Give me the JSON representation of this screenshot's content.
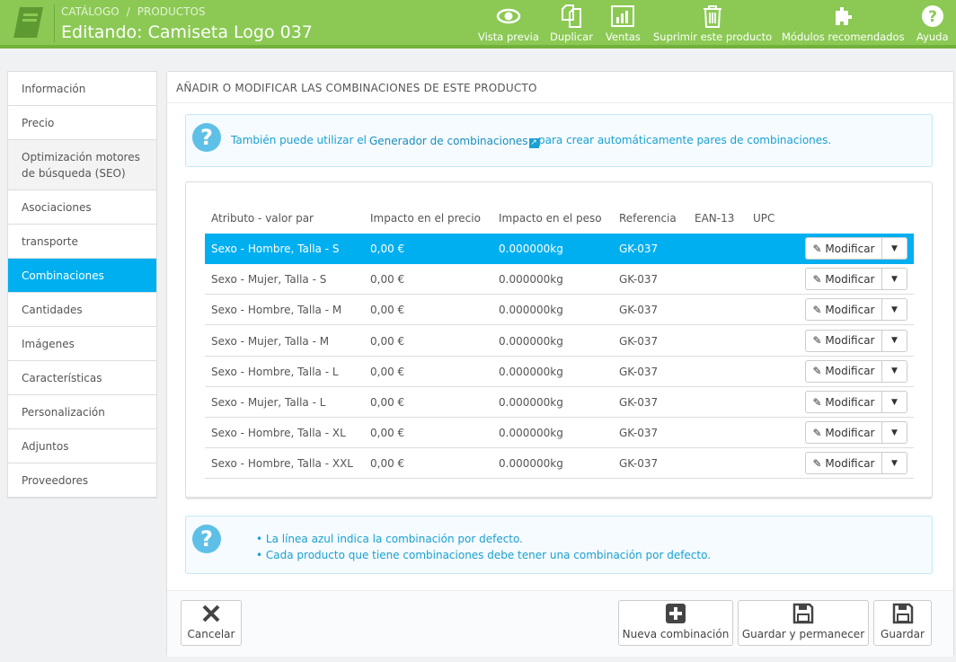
{
  "header": {
    "breadcrumb": [
      "CATÁLOGO",
      "/",
      "PRODUCTOS"
    ],
    "title": "Editando: Camiseta Logo 037",
    "toolbar": [
      {
        "label": "Vista previa",
        "icon": "eye-icon"
      },
      {
        "label": "Duplicar",
        "icon": "copy-icon"
      },
      {
        "label": "Ventas",
        "icon": "bar-chart-icon"
      },
      {
        "label": "Suprimir este producto",
        "icon": "trash-icon"
      },
      {
        "label": "Módulos recomendados",
        "icon": "puzzle-icon"
      },
      {
        "label": "Ayuda",
        "icon": "help-icon"
      }
    ]
  },
  "sidebar": {
    "items": [
      "Información",
      "Precio",
      "Optimización motores de búsqueda (SEO)",
      "Asociaciones",
      "transporte",
      "Combinaciones",
      "Cantidades",
      "Imágenes",
      "Características",
      "Personalización",
      "Adjuntos",
      "Proveedores"
    ],
    "active": "Combinaciones"
  },
  "panel": {
    "title": "Añadir o modificar las combinaciones de este producto",
    "info1": {
      "before": "También puede utilizar el",
      "link": "Generador de combinaciones",
      "after": "para crear automáticamente pares de combinaciones."
    },
    "table": {
      "headers": [
        "Atributo - valor par",
        "Impacto en el precio",
        "Impacto en el peso",
        "Referencia",
        "EAN-13",
        "UPC"
      ],
      "rows": [
        [
          "Sexo - Hombre, Talla - S",
          "0,00 €",
          "0.000000kg",
          "GK-037"
        ],
        [
          "Sexo - Mujer, Talla - S",
          "0,00 €",
          "0.000000kg",
          "GK-037"
        ],
        [
          "Sexo - Hombre, Talla - M",
          "0,00 €",
          "0.000000kg",
          "GK-037"
        ],
        [
          "Sexo - Mujer, Talla - M",
          "0,00 €",
          "0.000000kg",
          "GK-037"
        ],
        [
          "Sexo - Hombre, Talla - L",
          "0,00 €",
          "0.000000kg",
          "GK-037"
        ],
        [
          "Sexo - Mujer, Talla - L",
          "0,00 €",
          "0.000000kg",
          "GK-037"
        ],
        [
          "Sexo - Hombre, Talla - XL",
          "0,00 €",
          "0.000000kg",
          "GK-037"
        ],
        [
          "Sexo - Hombre, Talla - XXL",
          "0,00 €",
          "0.000000kg",
          "GK-037"
        ]
      ],
      "action_label": "Modificar"
    },
    "info2": [
      "La línea azul indica la combinación por defecto.",
      "Cada producto que tiene combinaciones debe tener una combinación por defecto."
    ],
    "buttons": {
      "cancel": "Cancelar",
      "new": "Nueva combinación",
      "save_stay": "Guardar y permanecer",
      "save": "Guardar"
    }
  },
  "colors": {
    "header": "#8bc954",
    "accent": "#00aff0",
    "info": "#1ba0d2"
  }
}
